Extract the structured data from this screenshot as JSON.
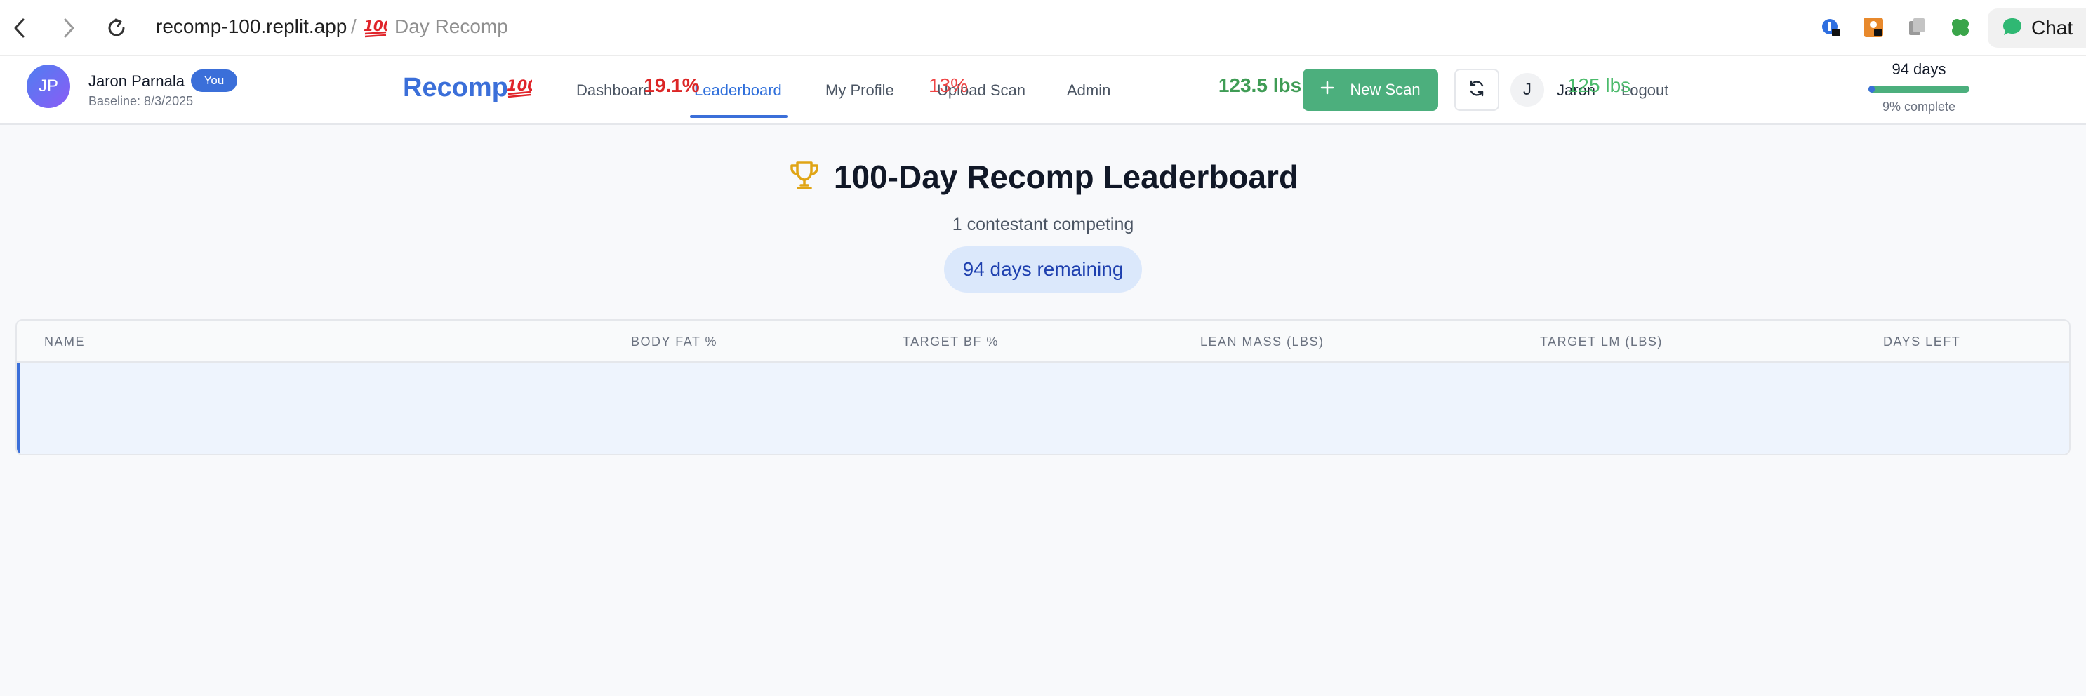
{
  "browser": {
    "url_host": "recomp-100.replit.app",
    "url_separator": "/",
    "tab_title": "Day Recomp",
    "tab_emoji": "💯",
    "chat_label": "Chat"
  },
  "header": {
    "logo_text": "Recomp",
    "logo_emoji": "💯",
    "nav": [
      {
        "label": "Dashboard"
      },
      {
        "label": "Leaderboard"
      },
      {
        "label": "My Profile"
      },
      {
        "label": "Upload Scan"
      },
      {
        "label": "Admin"
      }
    ],
    "active_nav": "Leaderboard",
    "new_scan_label": "New Scan",
    "user_initial": "J",
    "user_name": "Jaron",
    "logout_label": "Logout"
  },
  "page": {
    "title": "100-Day Recomp Leaderboard",
    "title_icon": "trophy-icon",
    "subtitle": "1 contestant competing",
    "days_remaining": "94 days remaining"
  },
  "table": {
    "columns": [
      "NAME",
      "BODY FAT %",
      "TARGET BF %",
      "LEAN MASS (LBS)",
      "TARGET LM (LBS)",
      "DAYS LEFT"
    ],
    "rows": [
      {
        "initials": "JP",
        "name": "Jaron Parnala",
        "badge": "You",
        "baseline": "Baseline: 8/3/2025",
        "body_fat": "19.1%",
        "target_bf": "13%",
        "lean_mass": "123.5 lbs",
        "target_lm": "125 lbs",
        "days_left": "94 days",
        "progress_fraction": 0.06,
        "progress_text": "9% complete"
      }
    ]
  },
  "colors": {
    "accent": "#3b6fd9",
    "success": "#4caf7d",
    "danger": "#dc2626"
  }
}
